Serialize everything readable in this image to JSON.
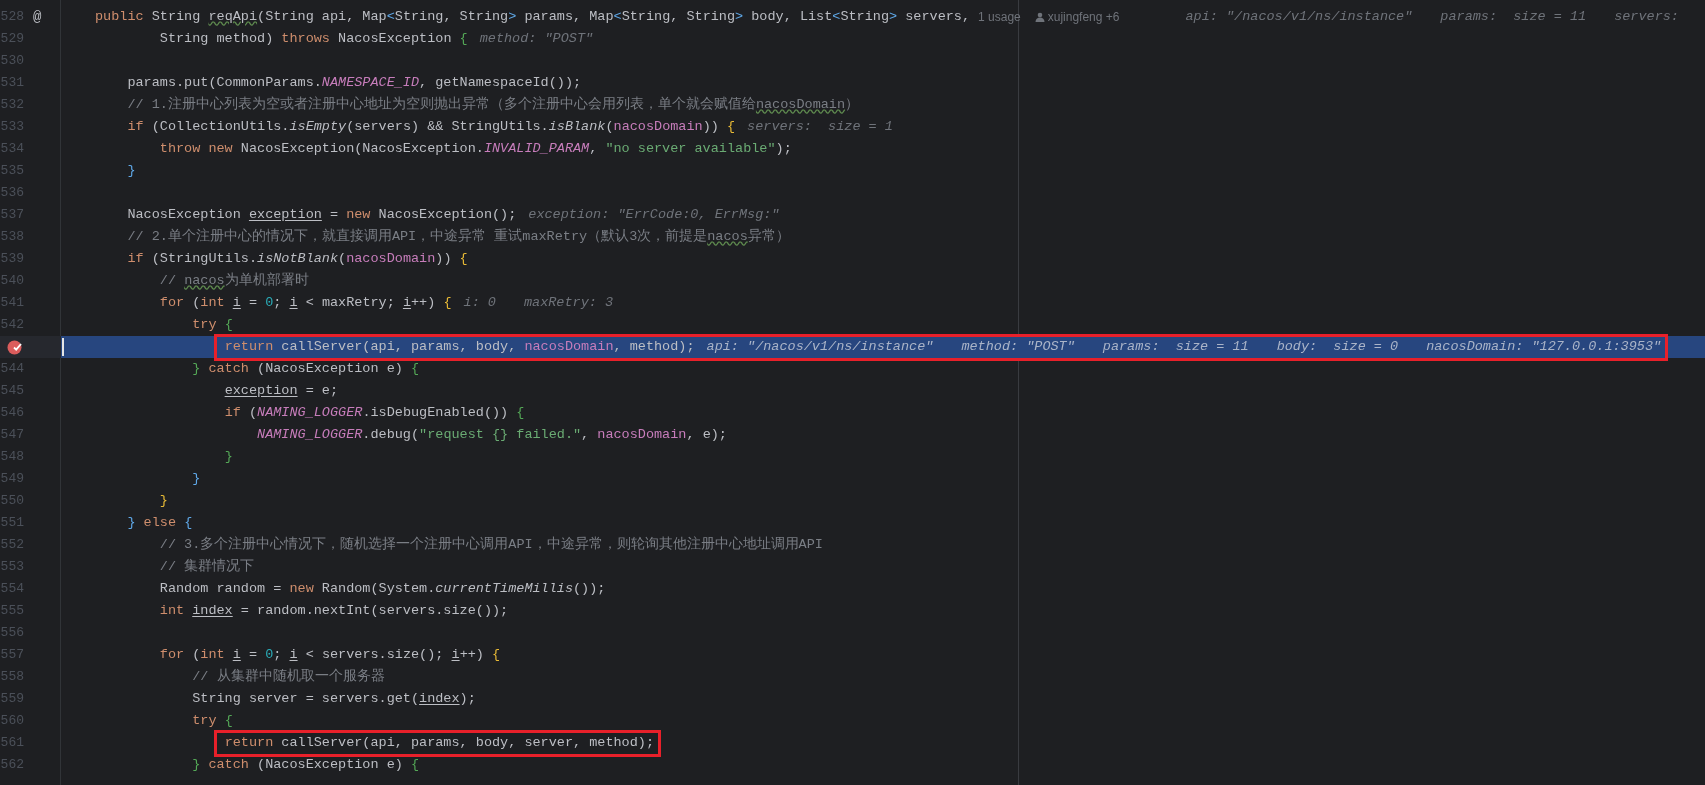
{
  "editor": {
    "lines": [
      {
        "number": "528",
        "gutter_mark": "@",
        "current": false,
        "breakpoint": false,
        "boxed": false,
        "tokens": [
          {
            "kind": "keyword",
            "text": "public "
          },
          {
            "kind": "plain",
            "text": "String "
          },
          {
            "kind": "typo",
            "text": "reqApi"
          },
          {
            "kind": "plain",
            "text": "(String api, Map"
          },
          {
            "kind": "brace_blue",
            "text": "<"
          },
          {
            "kind": "plain",
            "text": "String, String"
          },
          {
            "kind": "brace_blue",
            "text": ">"
          },
          {
            "kind": "plain",
            "text": " params, Map"
          },
          {
            "kind": "brace_blue",
            "text": "<"
          },
          {
            "kind": "plain",
            "text": "String, String"
          },
          {
            "kind": "brace_blue",
            "text": ">"
          },
          {
            "kind": "plain",
            "text": " body, List"
          },
          {
            "kind": "brace_blue",
            "text": "<"
          },
          {
            "kind": "plain",
            "text": "String"
          },
          {
            "kind": "brace_blue",
            "text": ">"
          },
          {
            "kind": "plain",
            "text": " servers,"
          }
        ],
        "usage": "1 usage",
        "author": "xujingfeng +6",
        "hints": [
          "api: \"/nacos/v1/ns/instance\"",
          "params:  size = 11",
          "servers:"
        ]
      },
      {
        "number": "529",
        "current": false,
        "breakpoint": false,
        "boxed": false,
        "tokens": [
          {
            "kind": "plain",
            "text": "        String method) "
          },
          {
            "kind": "keyword",
            "text": "throws "
          },
          {
            "kind": "plain",
            "text": "NacosException "
          },
          {
            "kind": "brace_green",
            "text": "{"
          }
        ],
        "hints": [
          "method: \"POST\""
        ]
      },
      {
        "number": "530",
        "current": false,
        "breakpoint": false,
        "boxed": false
      },
      {
        "number": "531",
        "current": false,
        "breakpoint": false,
        "boxed": false,
        "tokens": [
          {
            "kind": "plain",
            "text": "    params.put(CommonParams."
          },
          {
            "kind": "constant",
            "text": "NAMESPACE_ID"
          },
          {
            "kind": "plain",
            "text": ", getNamespaceId());"
          }
        ]
      },
      {
        "number": "532",
        "current": false,
        "breakpoint": false,
        "boxed": false,
        "tokens": [
          {
            "kind": "comment",
            "text": "    // 1.注册中心列表为空或者注册中心地址为空则抛出异常（多个注册中心会用列表，单个就会赋值给"
          },
          {
            "kind": "comment_typo",
            "text": "nacosDomain"
          },
          {
            "kind": "comment",
            "text": "）"
          }
        ]
      },
      {
        "number": "533",
        "current": false,
        "breakpoint": false,
        "boxed": false,
        "tokens": [
          {
            "kind": "keyword",
            "text": "    if "
          },
          {
            "kind": "plain",
            "text": "(CollectionUtils."
          },
          {
            "kind": "static_call",
            "text": "isEmpty"
          },
          {
            "kind": "plain",
            "text": "(servers) && StringUtils."
          },
          {
            "kind": "static_call",
            "text": "isBlank"
          },
          {
            "kind": "plain",
            "text": "("
          },
          {
            "kind": "field",
            "text": "nacosDomain"
          },
          {
            "kind": "plain",
            "text": ")) "
          },
          {
            "kind": "brace_yellow",
            "text": "{"
          }
        ],
        "hints": [
          "servers:  size = 1"
        ]
      },
      {
        "number": "534",
        "current": false,
        "breakpoint": false,
        "boxed": false,
        "tokens": [
          {
            "kind": "keyword",
            "text": "        throw new "
          },
          {
            "kind": "plain",
            "text": "NacosException(NacosException."
          },
          {
            "kind": "constant",
            "text": "INVALID_PARAM"
          },
          {
            "kind": "plain",
            "text": ", "
          },
          {
            "kind": "string",
            "text": "\"no server available\""
          },
          {
            "kind": "plain",
            "text": ");"
          }
        ]
      },
      {
        "number": "535",
        "current": false,
        "breakpoint": false,
        "boxed": false,
        "tokens": [
          {
            "kind": "brace_blue",
            "text": "    }"
          }
        ]
      },
      {
        "number": "536",
        "current": false,
        "breakpoint": false,
        "boxed": false
      },
      {
        "number": "537",
        "current": false,
        "breakpoint": false,
        "boxed": false,
        "tokens": [
          {
            "kind": "plain",
            "text": "    NacosException "
          },
          {
            "kind": "local_var",
            "text": "exception"
          },
          {
            "kind": "plain",
            "text": " = "
          },
          {
            "kind": "keyword",
            "text": "new "
          },
          {
            "kind": "plain",
            "text": "NacosException();"
          }
        ],
        "hints": [
          "exception: \"ErrCode:0, ErrMsg:\""
        ]
      },
      {
        "number": "538",
        "current": false,
        "breakpoint": false,
        "boxed": false,
        "tokens": [
          {
            "kind": "comment",
            "text": "    // 2.单个注册中心的情况下，就直接调用API，中途异常 重试maxRetry（默认3次，前提是"
          },
          {
            "kind": "comment_typo",
            "text": "nacos"
          },
          {
            "kind": "comment",
            "text": "异常）"
          }
        ]
      },
      {
        "number": "539",
        "current": false,
        "breakpoint": false,
        "boxed": false,
        "tokens": [
          {
            "kind": "keyword",
            "text": "    if "
          },
          {
            "kind": "plain",
            "text": "(StringUtils."
          },
          {
            "kind": "static_call",
            "text": "isNotBlank"
          },
          {
            "kind": "plain",
            "text": "("
          },
          {
            "kind": "field",
            "text": "nacosDomain"
          },
          {
            "kind": "plain",
            "text": ")) "
          },
          {
            "kind": "brace_yellow",
            "text": "{"
          }
        ]
      },
      {
        "number": "540",
        "current": false,
        "breakpoint": false,
        "boxed": false,
        "tokens": [
          {
            "kind": "comment",
            "text": "        // "
          },
          {
            "kind": "comment_typo",
            "text": "nacos"
          },
          {
            "kind": "comment",
            "text": "为单机部署时"
          }
        ]
      },
      {
        "number": "541",
        "current": false,
        "breakpoint": false,
        "boxed": false,
        "tokens": [
          {
            "kind": "keyword",
            "text": "        for "
          },
          {
            "kind": "plain",
            "text": "("
          },
          {
            "kind": "keyword",
            "text": "int "
          },
          {
            "kind": "local_var",
            "text": "i"
          },
          {
            "kind": "plain",
            "text": " = "
          },
          {
            "kind": "number",
            "text": "0"
          },
          {
            "kind": "plain",
            "text": "; "
          },
          {
            "kind": "local_var",
            "text": "i"
          },
          {
            "kind": "plain",
            "text": " < maxRetry; "
          },
          {
            "kind": "local_var",
            "text": "i"
          },
          {
            "kind": "plain",
            "text": "++) "
          },
          {
            "kind": "brace_yellow",
            "text": "{"
          }
        ],
        "hints": [
          "i: 0",
          "maxRetry: 3"
        ]
      },
      {
        "number": "542",
        "current": false,
        "breakpoint": false,
        "boxed": false,
        "tokens": [
          {
            "kind": "keyword",
            "text": "            try "
          },
          {
            "kind": "brace_green",
            "text": "{"
          }
        ]
      },
      {
        "current": true,
        "breakpoint": true,
        "boxed": true,
        "tokens": [
          {
            "kind": "keyword",
            "text": "                return "
          },
          {
            "kind": "plain",
            "text": "callServer(api, params, body, "
          },
          {
            "kind": "field",
            "text": "nacosDomain"
          },
          {
            "kind": "plain",
            "text": ", method);"
          }
        ],
        "hints": [
          "api: \"/nacos/v1/ns/instance\"",
          "method: \"POST\"",
          "params:  size = 11",
          "body:  size = 0",
          "nacosDomain: \"127.0.0.1:3953\""
        ]
      },
      {
        "number": "544",
        "current": false,
        "breakpoint": false,
        "boxed": false,
        "tokens": [
          {
            "kind": "brace_green",
            "text": "            } "
          },
          {
            "kind": "keyword",
            "text": "catch "
          },
          {
            "kind": "plain",
            "text": "(NacosException e) "
          },
          {
            "kind": "brace_green",
            "text": "{"
          }
        ]
      },
      {
        "number": "545",
        "current": false,
        "breakpoint": false,
        "boxed": false,
        "tokens": [
          {
            "kind": "local_var",
            "text": "                exception"
          },
          {
            "kind": "plain",
            "text": " = e;"
          }
        ]
      },
      {
        "number": "546",
        "current": false,
        "breakpoint": false,
        "boxed": false,
        "tokens": [
          {
            "kind": "keyword",
            "text": "                if "
          },
          {
            "kind": "plain",
            "text": "("
          },
          {
            "kind": "constant",
            "text": "NAMING_LOGGER"
          },
          {
            "kind": "plain",
            "text": ".isDebugEnabled()) "
          },
          {
            "kind": "brace_green",
            "text": "{"
          }
        ]
      },
      {
        "number": "547",
        "current": false,
        "breakpoint": false,
        "boxed": false,
        "tokens": [
          {
            "kind": "constant",
            "text": "                    NAMING_LOGGER"
          },
          {
            "kind": "plain",
            "text": ".debug("
          },
          {
            "kind": "string",
            "text": "\"request {} failed.\""
          },
          {
            "kind": "plain",
            "text": ", "
          },
          {
            "kind": "field",
            "text": "nacosDomain"
          },
          {
            "kind": "plain",
            "text": ", e);"
          }
        ]
      },
      {
        "number": "548",
        "current": false,
        "breakpoint": false,
        "boxed": false,
        "tokens": [
          {
            "kind": "brace_green",
            "text": "                }"
          }
        ]
      },
      {
        "number": "549",
        "current": false,
        "breakpoint": false,
        "boxed": false,
        "tokens": [
          {
            "kind": "brace_blue",
            "text": "            }"
          }
        ]
      },
      {
        "number": "550",
        "current": false,
        "breakpoint": false,
        "boxed": false,
        "tokens": [
          {
            "kind": "brace_yellow",
            "text": "        }"
          }
        ]
      },
      {
        "number": "551",
        "current": false,
        "breakpoint": false,
        "boxed": false,
        "tokens": [
          {
            "kind": "brace_blue",
            "text": "    } "
          },
          {
            "kind": "keyword",
            "text": "else "
          },
          {
            "kind": "brace_blue",
            "text": "{"
          }
        ]
      },
      {
        "number": "552",
        "current": false,
        "breakpoint": false,
        "boxed": false,
        "tokens": [
          {
            "kind": "comment",
            "text": "        // 3.多个注册中心情况下，随机选择一个注册中心调用API，中途异常，则轮询其他注册中心地址调用API"
          }
        ]
      },
      {
        "number": "553",
        "current": false,
        "breakpoint": false,
        "boxed": false,
        "tokens": [
          {
            "kind": "comment",
            "text": "        // 集群情况下"
          }
        ]
      },
      {
        "number": "554",
        "current": false,
        "breakpoint": false,
        "boxed": false,
        "tokens": [
          {
            "kind": "plain",
            "text": "        Random random = "
          },
          {
            "kind": "keyword",
            "text": "new "
          },
          {
            "kind": "plain",
            "text": "Random(System."
          },
          {
            "kind": "static_call",
            "text": "currentTimeMillis"
          },
          {
            "kind": "plain",
            "text": "());"
          }
        ]
      },
      {
        "number": "555",
        "current": false,
        "breakpoint": false,
        "boxed": false,
        "tokens": [
          {
            "kind": "keyword",
            "text": "        int "
          },
          {
            "kind": "local_var",
            "text": "index"
          },
          {
            "kind": "plain",
            "text": " = random.nextInt(servers.size());"
          }
        ]
      },
      {
        "number": "556",
        "current": false,
        "breakpoint": false,
        "boxed": false
      },
      {
        "number": "557",
        "current": false,
        "breakpoint": false,
        "boxed": false,
        "tokens": [
          {
            "kind": "keyword",
            "text": "        for "
          },
          {
            "kind": "plain",
            "text": "("
          },
          {
            "kind": "keyword",
            "text": "int "
          },
          {
            "kind": "local_var",
            "text": "i"
          },
          {
            "kind": "plain",
            "text": " = "
          },
          {
            "kind": "number",
            "text": "0"
          },
          {
            "kind": "plain",
            "text": "; "
          },
          {
            "kind": "local_var",
            "text": "i"
          },
          {
            "kind": "plain",
            "text": " < servers.size(); "
          },
          {
            "kind": "local_var",
            "text": "i"
          },
          {
            "kind": "plain",
            "text": "++) "
          },
          {
            "kind": "brace_yellow",
            "text": "{"
          }
        ]
      },
      {
        "number": "558",
        "current": false,
        "breakpoint": false,
        "boxed": false,
        "tokens": [
          {
            "kind": "comment",
            "text": "            // 从集群中随机取一个服务器"
          }
        ]
      },
      {
        "number": "559",
        "current": false,
        "breakpoint": false,
        "boxed": false,
        "tokens": [
          {
            "kind": "plain",
            "text": "            String server = servers.get("
          },
          {
            "kind": "local_var",
            "text": "index"
          },
          {
            "kind": "plain",
            "text": ");"
          }
        ]
      },
      {
        "number": "560",
        "current": false,
        "breakpoint": false,
        "boxed": false,
        "tokens": [
          {
            "kind": "keyword",
            "text": "            try "
          },
          {
            "kind": "brace_green",
            "text": "{"
          }
        ]
      },
      {
        "number": "561",
        "current": false,
        "breakpoint": false,
        "boxed": true,
        "tokens": [
          {
            "kind": "keyword",
            "text": "                return "
          },
          {
            "kind": "plain",
            "text": "callServer(api, params, body, server, method);"
          }
        ]
      },
      {
        "number": "562",
        "current": false,
        "breakpoint": false,
        "boxed": false,
        "tokens": [
          {
            "kind": "brace_green",
            "text": "            } "
          },
          {
            "kind": "keyword",
            "text": "catch "
          },
          {
            "kind": "plain",
            "text": "(NacosException e) "
          },
          {
            "kind": "brace_green",
            "text": "{"
          }
        ]
      }
    ]
  }
}
